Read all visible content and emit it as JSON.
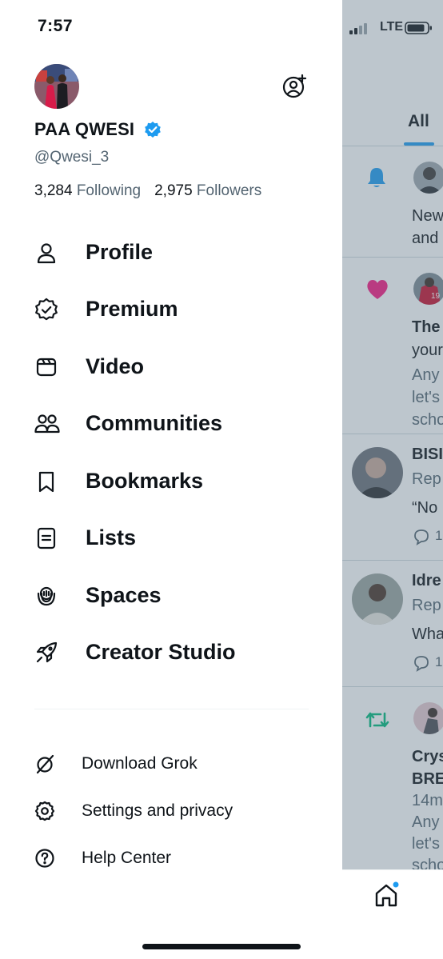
{
  "status_bar": {
    "time": "7:57",
    "network": "LTE"
  },
  "profile": {
    "name": "PAA QWESI",
    "handle": "@Qwesi_3",
    "following_count": "3,284",
    "following_label": "Following",
    "followers_count": "2,975",
    "followers_label": "Followers"
  },
  "menu": [
    {
      "label": "Profile",
      "icon": "person-icon"
    },
    {
      "label": "Premium",
      "icon": "verified-badge-icon"
    },
    {
      "label": "Video",
      "icon": "video-icon"
    },
    {
      "label": "Communities",
      "icon": "communities-icon"
    },
    {
      "label": "Bookmarks",
      "icon": "bookmark-icon"
    },
    {
      "label": "Lists",
      "icon": "lists-icon"
    },
    {
      "label": "Spaces",
      "icon": "spaces-icon"
    },
    {
      "label": "Creator Studio",
      "icon": "rocket-icon"
    }
  ],
  "secondary_menu": [
    {
      "label": "Download Grok",
      "icon": "grok-icon"
    },
    {
      "label": "Settings and privacy",
      "icon": "gear-icon"
    },
    {
      "label": "Help Center",
      "icon": "help-icon"
    }
  ],
  "feed": {
    "active_tab": "All",
    "items": [
      {
        "icon": "bell-icon",
        "lines": [
          "New",
          "and"
        ]
      },
      {
        "icon": "heart-icon",
        "lines": [
          "The",
          "your",
          "Any",
          "let's",
          "scho"
        ]
      },
      {
        "lines": [
          "BISI",
          "Rep",
          "“No",
          "1"
        ]
      },
      {
        "lines": [
          "Idre",
          "Rep",
          "Wha",
          "1"
        ]
      },
      {
        "icon": "retweet-icon",
        "lines": [
          "Crys",
          "BRE",
          "14m",
          "Any",
          "let's",
          "scho"
        ]
      }
    ]
  },
  "colors": {
    "accent": "#1d9bf0",
    "text_primary": "#0f1419",
    "text_secondary": "#536471",
    "like": "#f91880",
    "retweet": "#00ba7c"
  }
}
